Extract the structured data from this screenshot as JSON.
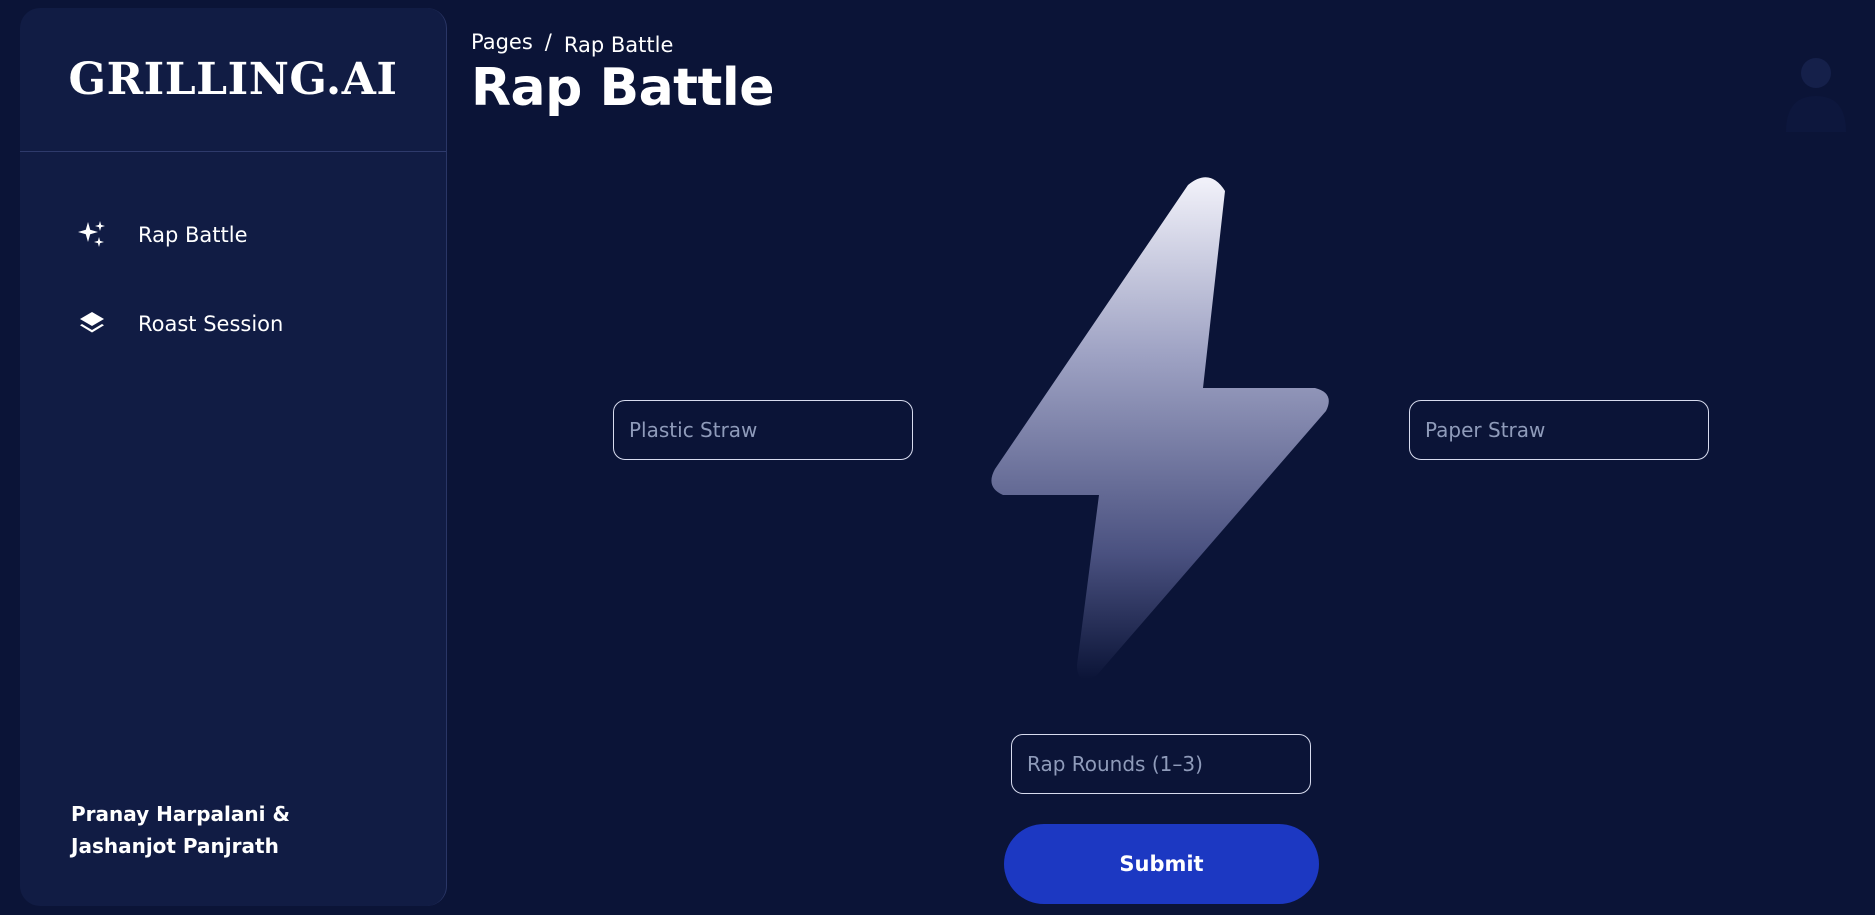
{
  "sidebar": {
    "brand": "GRILLING.AI",
    "items": [
      {
        "label": "Rap Battle",
        "icon": "sparkles-icon"
      },
      {
        "label": "Roast Session",
        "icon": "layers-icon"
      }
    ],
    "authors": "Pranay Harpalani & Jashanjot Panjrath"
  },
  "header": {
    "breadcrumb_root": "Pages",
    "breadcrumb_separator": "/",
    "breadcrumb_current": "Rap Battle",
    "title": "Rap Battle"
  },
  "main": {
    "left_input_placeholder": "Plastic Straw",
    "right_input_placeholder": "Paper Straw",
    "rounds_placeholder": "Rap Rounds (1–3)",
    "submit_label": "Submit",
    "center_icon": "lightning-bolt-icon"
  },
  "colors": {
    "background": "#0b1437",
    "sidebar": "#111c44",
    "accent": "#1c38c2",
    "input_border": "#d8dcef",
    "placeholder": "#8f9bba"
  }
}
